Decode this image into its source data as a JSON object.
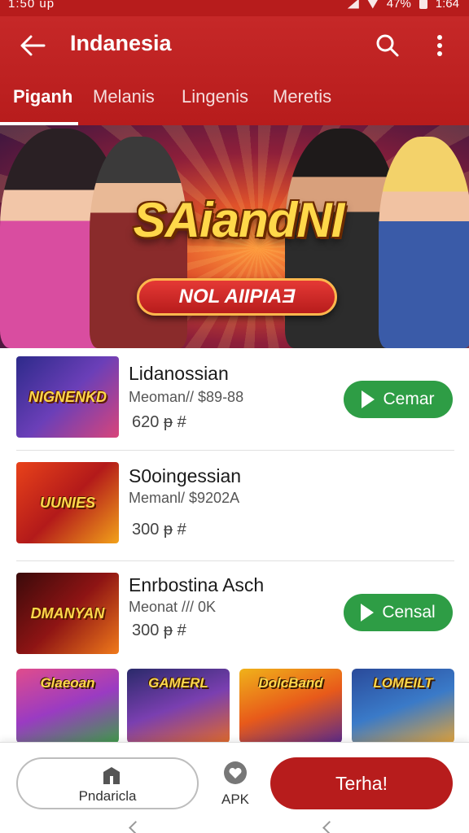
{
  "status_bar": {
    "time": "1:50 up",
    "battery": "47%",
    "clock_right": "1:64"
  },
  "header": {
    "title": "Indanesia",
    "back_icon": "arrow-left-icon",
    "search_icon": "search-icon",
    "more_icon": "more-vertical-icon"
  },
  "tabs": [
    {
      "label": "Piganh",
      "active": true
    },
    {
      "label": "Melanis",
      "active": false
    },
    {
      "label": "Lingenis",
      "active": false
    },
    {
      "label": "Meretis",
      "active": false
    }
  ],
  "banner": {
    "title": "SAiandNI",
    "button_label": "NOL AIIPIAƎ"
  },
  "list": [
    {
      "thumb_text": "NIGNENKD",
      "name": "Lidanossian",
      "meta": "Meoman// $89-88",
      "count": "620 ᵽ #",
      "button": "Cemar"
    },
    {
      "thumb_text": "UUNIES",
      "name": "S0oingessian",
      "meta": "Memanl/ $9202A",
      "count": "300 ᵽ #",
      "button": ""
    },
    {
      "thumb_text": "DMANYAN",
      "name": "Enrbostina Asch",
      "meta": "Meonat /// 0K",
      "count": "300 ᵽ #",
      "button": "Censal"
    }
  ],
  "grid": [
    {
      "text": "Glaeoan"
    },
    {
      "text": "GAMERL"
    },
    {
      "text": "DolcBand"
    },
    {
      "text": "LOMEILT"
    }
  ],
  "bottom": {
    "left_label": "Pndaricla",
    "apk_label": "APK",
    "primary_label": "Terha!"
  },
  "colors": {
    "brand": "#b71c1c",
    "accent_green": "#2e9d45",
    "banner_title": "#ffd84a"
  }
}
